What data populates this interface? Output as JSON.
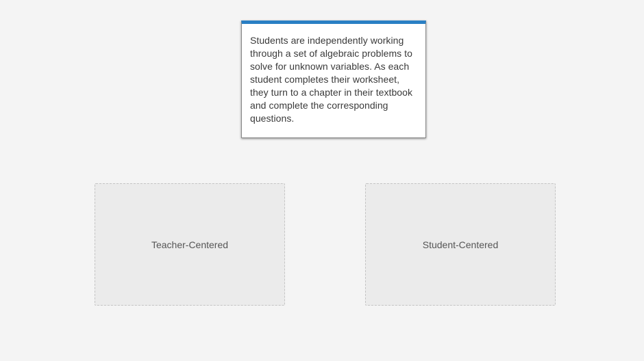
{
  "drag_card": {
    "text": "Students are independently working through a set of algebraic problems to solve for unknown variables. As each student completes their worksheet, they turn to a chapter in their textbook and complete the corresponding questions.",
    "accent_color": "#2a7fc4"
  },
  "drop_zones": [
    {
      "label": "Teacher-Centered"
    },
    {
      "label": "Student-Centered"
    }
  ]
}
